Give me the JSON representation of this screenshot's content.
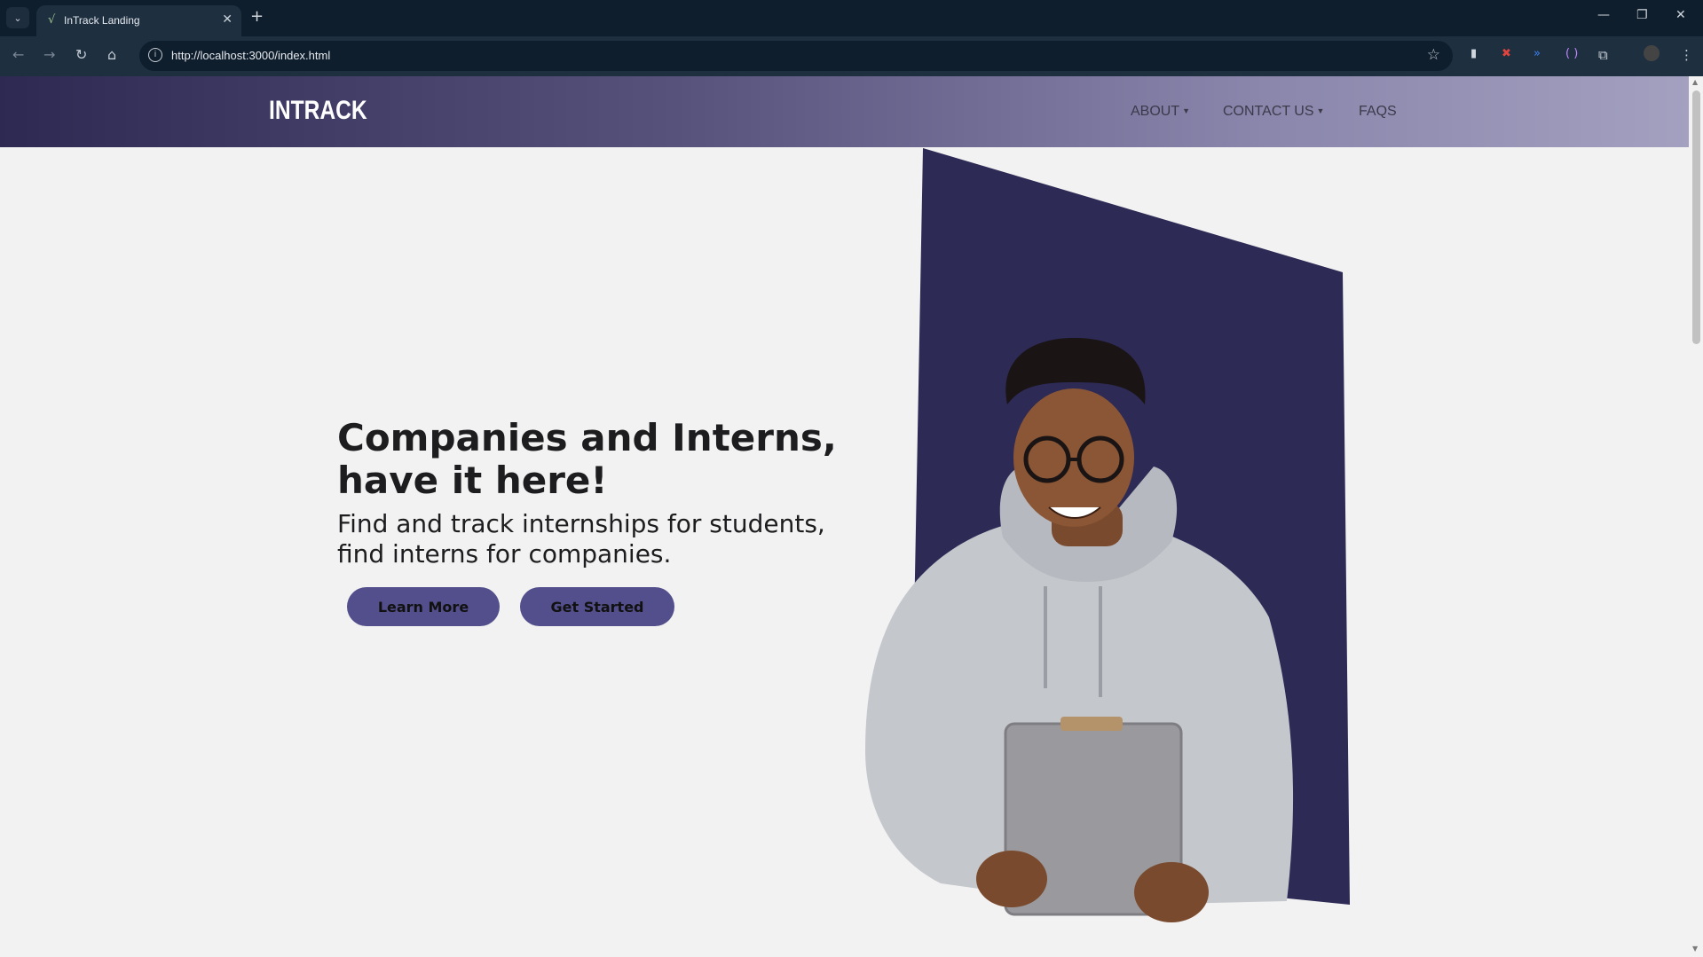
{
  "browser": {
    "tab_title": "InTrack Landing",
    "url": "http://localhost:3000/index.html",
    "icons": [
      "tab-search-icon",
      "close-icon",
      "plus-icon",
      "minimize-icon",
      "restore-icon",
      "window-close-icon",
      "back-icon",
      "forward-icon",
      "reload-icon",
      "home-icon",
      "info-icon",
      "star-icon",
      "extension-icon",
      "profile-icon",
      "menu-icon"
    ]
  },
  "site": {
    "logo": "INTRACK",
    "nav": [
      {
        "label": "ABOUT",
        "has_dropdown": true
      },
      {
        "label": "CONTACT US",
        "has_dropdown": true
      },
      {
        "label": "FAQS",
        "has_dropdown": false
      }
    ]
  },
  "hero": {
    "headline": "Companies and Interns, have it here!",
    "subheadline": "Find and track internships for students, find interns for companies.",
    "primary_button": "Learn More",
    "secondary_button": "Get Started",
    "image_description_icon": "student-with-clipboard-image"
  },
  "colors": {
    "header_start": "#2d2952",
    "header_end": "#a3a0c0",
    "accent": "#534f8c",
    "panel": "#2d2a55",
    "page_bg": "#f2f2f2"
  }
}
